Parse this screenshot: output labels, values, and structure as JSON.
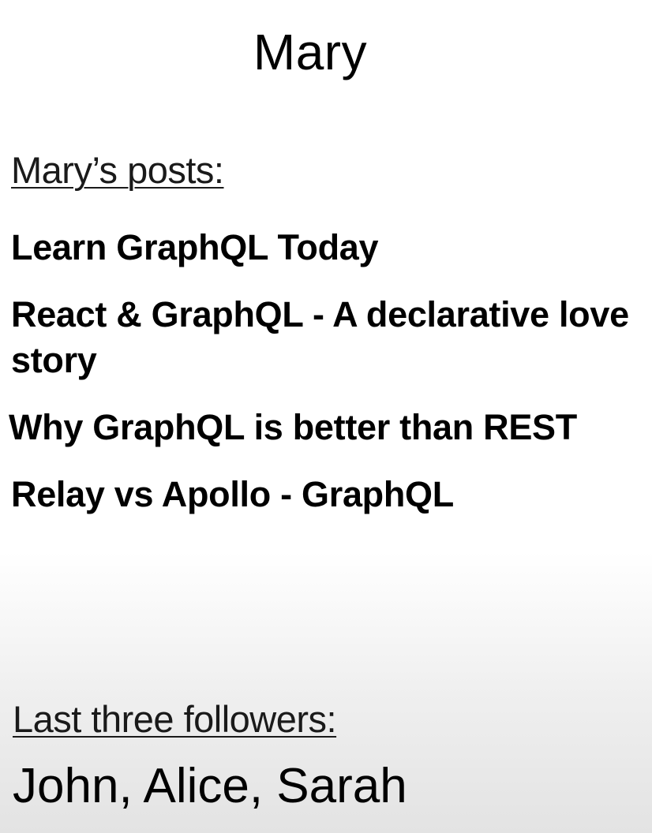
{
  "profile": {
    "name": "Mary"
  },
  "posts_section": {
    "heading": "Mary’s posts:",
    "posts": [
      "Learn GraphQL Today",
      "React & GraphQL - A declarative love story",
      "Why GraphQL is better than REST",
      "Relay vs Apollo - GraphQL"
    ]
  },
  "followers_section": {
    "heading": "Last three followers:",
    "followers": "John, Alice, Sarah"
  }
}
